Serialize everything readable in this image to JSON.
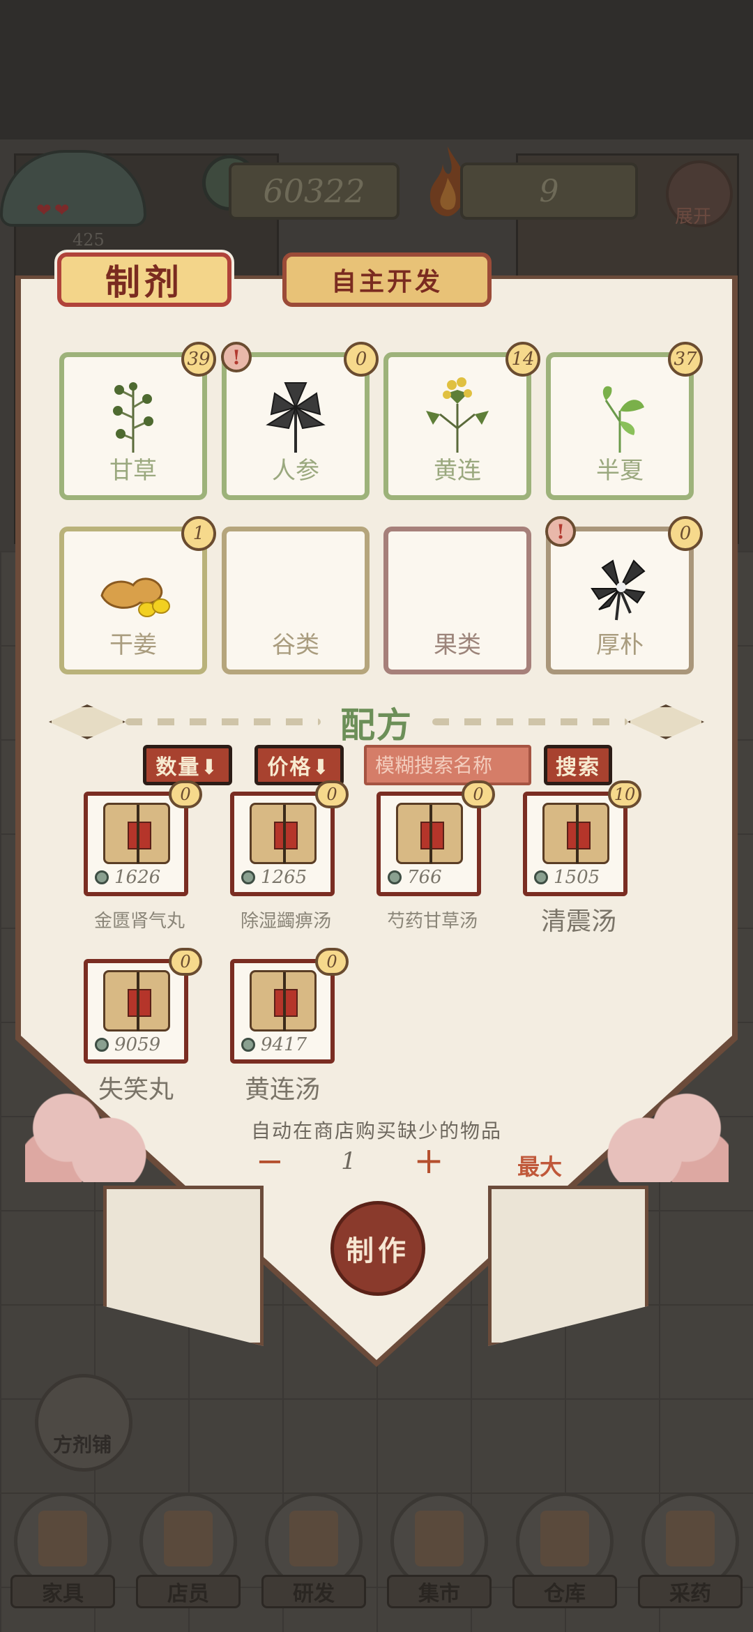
{
  "hud": {
    "coins": "60322",
    "fire": "9",
    "level": "425",
    "expand_label": "展开",
    "hearts": "❤❤"
  },
  "tabs": {
    "active": "制剂",
    "inactive": "自主开发"
  },
  "herbs": [
    {
      "name": "甘草",
      "count": "39"
    },
    {
      "name": "人参",
      "count": "0",
      "alert": "!"
    },
    {
      "name": "黄连",
      "count": "14"
    },
    {
      "name": "半夏",
      "count": "37"
    },
    {
      "name": "干姜",
      "count": "1"
    },
    {
      "name": "谷类",
      "count": ""
    },
    {
      "name": "果类",
      "count": ""
    },
    {
      "name": "厚朴",
      "count": "0",
      "alert": "!"
    }
  ],
  "recipe_section": {
    "title": "配方",
    "sort_quantity": "数量⬇",
    "sort_price": "价格⬇",
    "search_placeholder": "模糊搜索名称",
    "search_button": "搜索"
  },
  "recipes": [
    {
      "name": "金匮肾气丸",
      "price": "1626",
      "count": "0"
    },
    {
      "name": "除湿蠲痹汤",
      "price": "1265",
      "count": "0"
    },
    {
      "name": "芍药甘草汤",
      "price": "766",
      "count": "0"
    },
    {
      "name": "清震汤",
      "price": "1505",
      "count": "10"
    },
    {
      "name": "失笑丸",
      "price": "9059",
      "count": "0"
    },
    {
      "name": "黄连汤",
      "price": "9417",
      "count": "0"
    }
  ],
  "controls": {
    "auto_buy_text": "自动在商店购买缺少的物品",
    "minus": "−",
    "quantity": "1",
    "plus": "+",
    "max": "最大",
    "make": "制作"
  },
  "shop": {
    "label": "方剂铺"
  },
  "nav": [
    {
      "label": "家具",
      "icon": "chair-icon"
    },
    {
      "label": "店员",
      "icon": "staff-icon"
    },
    {
      "label": "研发",
      "icon": "research-icon"
    },
    {
      "label": "集市",
      "icon": "market-icon"
    },
    {
      "label": "仓库",
      "icon": "warehouse-icon"
    },
    {
      "label": "采药",
      "icon": "mountain-icon"
    }
  ],
  "colors": {
    "panel_bg": "#f3ede1",
    "accent_red": "#a8422f",
    "tab_gold": "#f3d58a",
    "herb_green": "#9db27a"
  }
}
